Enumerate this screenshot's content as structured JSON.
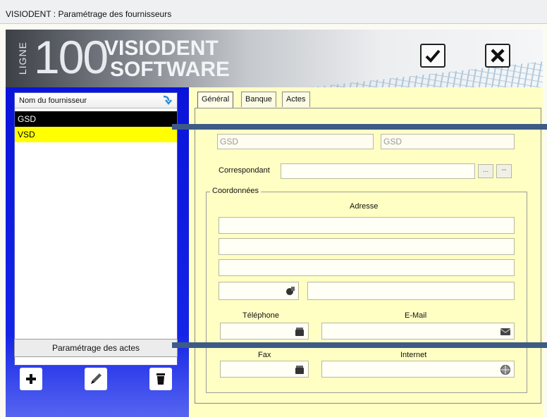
{
  "window": {
    "title": "VISIODENT : Paramétrage des fournisseurs"
  },
  "banner": {
    "ligne": "LIGNE",
    "number": "100",
    "brand_line1": "VISIODENT",
    "brand_line2": "SOFTWARE"
  },
  "toolbar": {
    "validate_icon": "check-icon",
    "cancel_icon": "close-icon"
  },
  "supplier_list": {
    "header": "Nom du fournisseur",
    "rows": [
      "GSD",
      "VSD"
    ],
    "selected_index": 0
  },
  "buttons": {
    "acts_settings": "Paramétrage des actes",
    "add_icon": "plus-icon",
    "edit_icon": "pencil-icon",
    "delete_icon": "trash-icon"
  },
  "tabs": [
    "Général",
    "Banque",
    "Actes"
  ],
  "general": {
    "name_value": "GSD",
    "short_name_value": "GSD",
    "correspondant_label": "Correspondant",
    "coords_legend": "Coordonnées",
    "adresse_label": "Adresse",
    "telephone_label": "Téléphone",
    "email_label": "E-Mail",
    "fax_label": "Fax",
    "internet_label": "Internet",
    "browse_label": "...",
    "clear_label": "--"
  },
  "colors": {
    "left_panel": "#1424e6",
    "right_panel": "#ffffc4",
    "selected_row": "#000000",
    "highlight_row": "#ffff00"
  }
}
